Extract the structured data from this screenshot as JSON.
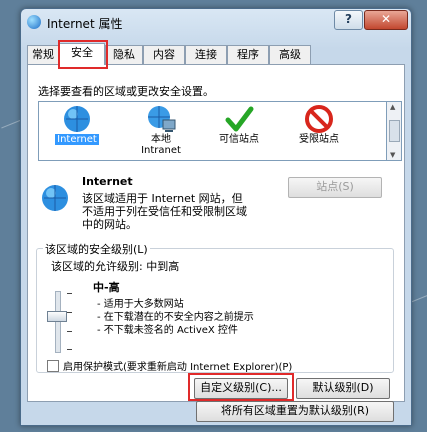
{
  "window": {
    "title": "Internet 属性",
    "help_glyph": "?",
    "close_glyph": "✕"
  },
  "tabs": [
    "常规",
    "安全",
    "隐私",
    "内容",
    "连接",
    "程序",
    "高级"
  ],
  "security": {
    "instruction": "选择要查看的区域或更改安全设置。",
    "zones": [
      {
        "label": "Internet",
        "icon": "globe-icon"
      },
      {
        "label": "本地\nIntranet",
        "icon": "local-intranet-icon"
      },
      {
        "label": "可信站点",
        "icon": "green-check-icon"
      },
      {
        "label": "受限站点",
        "icon": "red-no-entry-icon"
      }
    ],
    "zone_title": "Internet",
    "zone_description": [
      "该区域适用于 Internet 网站，但",
      "不适用于列在受信任和受限制区域",
      "中的网站。"
    ],
    "sites_button": "站点(S)",
    "level_group_title": "该区域的安全级别(L)",
    "allowed_levels": "该区域的允许级别: 中到高",
    "level_name": "中-高",
    "level_points": [
      "- 适用于大多数网站",
      "- 在下载潜在的不安全内容之前提示",
      "- 不下载未签名的 ActiveX 控件"
    ],
    "protected_mode": "启用保护模式(要求重新启动 Internet Explorer)(P)",
    "custom_level_button": "自定义级别(C)...",
    "default_level_button": "默认级别(D)",
    "reset_all_button": "将所有区域重置为默认级别(R)"
  },
  "colors": {
    "highlight_box": "#e02a2a",
    "selection": "#3399ff"
  }
}
